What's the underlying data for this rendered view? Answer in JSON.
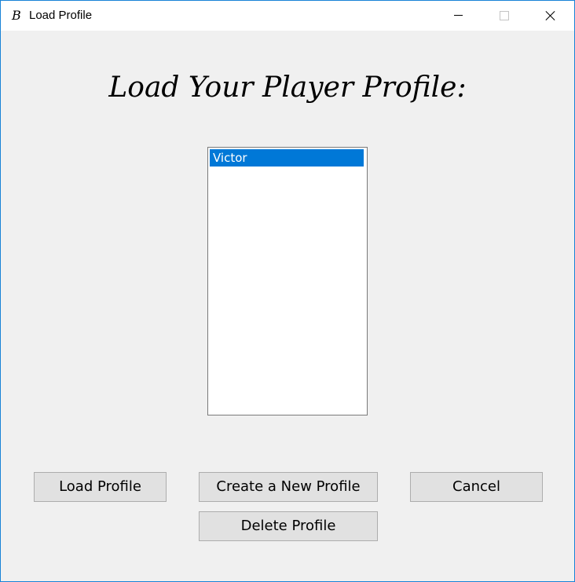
{
  "window": {
    "title": "Load Profile",
    "icon": "B",
    "accent_color": "#1883d7"
  },
  "main": {
    "heading": "Load Your Player Profile:",
    "profiles": [
      {
        "name": "Victor",
        "selected": true
      }
    ],
    "selection_color": "#0078d7"
  },
  "buttons": {
    "load": "Load Profile",
    "create": "Create a New Profile",
    "cancel": "Cancel",
    "delete": "Delete Profile"
  }
}
